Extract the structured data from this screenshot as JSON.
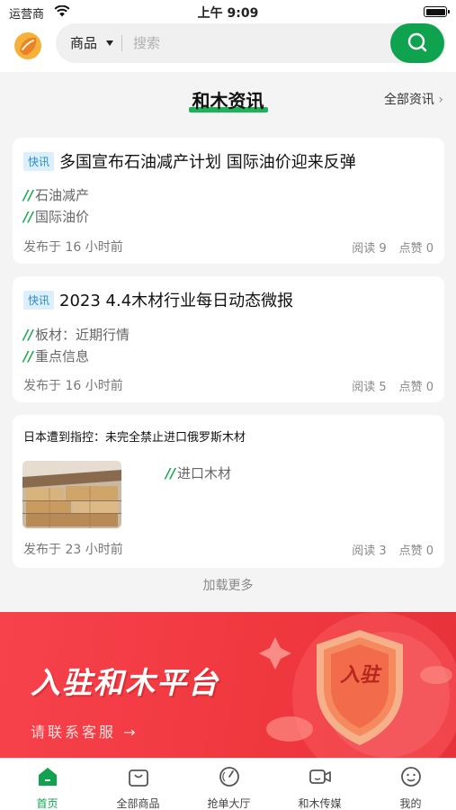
{
  "status_bar": {
    "carrier": "运营商",
    "time": "上午 9:09"
  },
  "search": {
    "category": "商品",
    "placeholder": "搜索"
  },
  "section": {
    "title": "和木资讯",
    "more_link": "全部资讯"
  },
  "news": [
    {
      "tag": "快讯",
      "title": "多国宣布石油减产计划 国际油价迎来反弹",
      "keywords": [
        "石油减产",
        "国际油价"
      ],
      "published": "发布于 16 小时前",
      "reads": "阅读 9",
      "likes": "点赞 0"
    },
    {
      "tag": "快讯",
      "title": "2023 4.4木材行业每日动态微报",
      "keywords": [
        "板材：近期行情",
        "重点信息"
      ],
      "published": "发布于 16 小时前",
      "reads": "阅读 5",
      "likes": "点赞 0"
    },
    {
      "title": "日本遭到指控：未完全禁止进口俄罗斯木材",
      "keywords": [
        "进口木材"
      ],
      "published": "发布于 23 小时前",
      "reads": "阅读 3",
      "likes": "点赞 0"
    }
  ],
  "load_more": "加载更多",
  "banner": {
    "title": "入驻和木平台",
    "subtitle": "请联系客服 →",
    "badge": "入驻"
  },
  "tabs": [
    {
      "label": "首页",
      "icon": "home-icon",
      "active": true
    },
    {
      "label": "全部商品",
      "icon": "shopping-bag-icon",
      "active": false
    },
    {
      "label": "抢单大厅",
      "icon": "timer-icon",
      "active": false
    },
    {
      "label": "和木传媒",
      "icon": "video-camera-icon",
      "active": false
    },
    {
      "label": "我的",
      "icon": "smiley-face-icon",
      "active": false
    }
  ],
  "colors": {
    "brand_green": "#0fa34f",
    "banner_red": "#f0383f",
    "tag_blue": "#2a8ccf"
  }
}
